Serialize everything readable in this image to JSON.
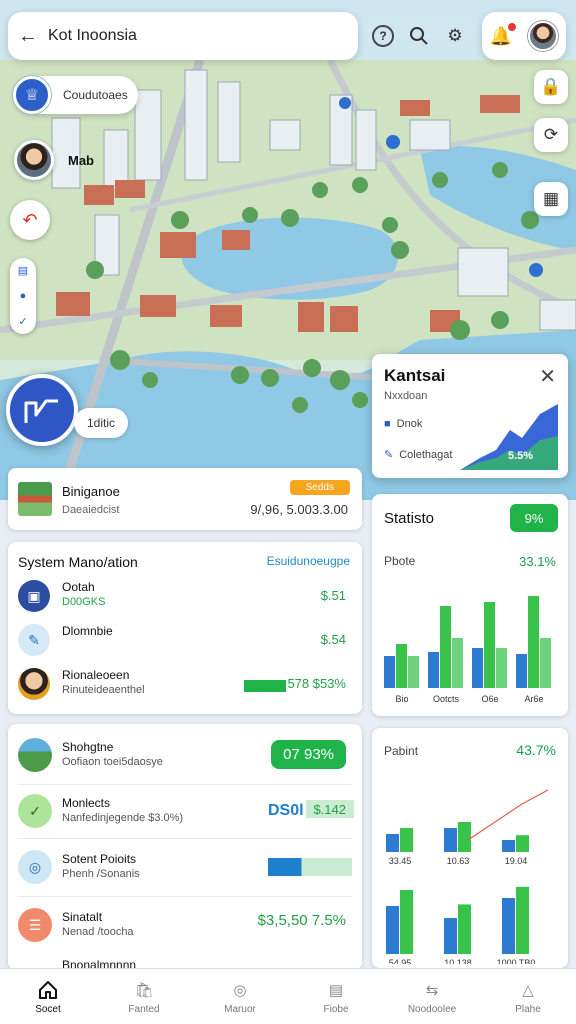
{
  "topbar": {
    "title": "Kot Inoonsia"
  },
  "map": {
    "pill_label": "Coudutoaes",
    "person_label": "Mab",
    "fab_label": "1ditic"
  },
  "popup": {
    "title": "Kantsai",
    "subtitle": "Nxxdoan",
    "item1": "Dnok",
    "item2": "Colethagat",
    "value": "5.5%"
  },
  "bin_card": {
    "title": "Biniganoe",
    "subtitle": "Daeaiedcist",
    "badge": "Sedds",
    "amount": "9/,96, 5.003.3.00"
  },
  "system_card": {
    "header": "System Mano/ation",
    "link": "Esuidunoeugpe",
    "rows": [
      {
        "title": "Ootah",
        "subtitle": "D00GKS",
        "value": "$.51"
      },
      {
        "title": "Dlomnbie",
        "subtitle": "",
        "value": "$.54"
      },
      {
        "title": "Rionaleoeen",
        "subtitle": "Rinuteideaenthel",
        "value": "578 $53%"
      }
    ]
  },
  "shops_card": {
    "rows": [
      {
        "title": "Shohgtne",
        "subtitle": "Oofiaon toei5daosye",
        "pill": "07 93%"
      },
      {
        "title": "Monlects",
        "subtitle": "Nanfedinjegende $3.0%)",
        "value": "DS0l",
        "value2": "$.142"
      },
      {
        "title": "Sotent Poioits",
        "subtitle": "Phenh /Sonanis",
        "value": ""
      },
      {
        "title": "Sinatalt",
        "subtitle": "Nenad /toocha",
        "value": "$3,5,50 7.5%"
      },
      {
        "title": "Bnonalmnnnn",
        "subtitle": "",
        "value": ""
      }
    ]
  },
  "stats_card": {
    "title": "Statisto",
    "badge": "9%",
    "label": "Pbote",
    "value": "33.1%"
  },
  "patients_card": {
    "label": "Pabint",
    "value": "43.7%"
  },
  "chart_data": [
    {
      "type": "bar",
      "categories": [
        "Bio",
        "Ootcts",
        "O6e",
        "Ar6e"
      ],
      "series": [
        {
          "values": [
            32,
            36,
            40,
            34
          ]
        },
        {
          "values": [
            44,
            82,
            86,
            92
          ]
        },
        {
          "values": [
            32,
            50,
            40,
            50
          ]
        }
      ],
      "colors": [
        "#2c7bd1",
        "#3ac34b",
        "#6cd37c"
      ]
    },
    {
      "type": "bar",
      "categories_top": [
        "33.45",
        "10.63",
        "19.04"
      ],
      "categories_bottom": [
        "54 95",
        "10 138",
        "1000 TB0"
      ],
      "series": [
        {
          "values": [
            30,
            40,
            20,
            60,
            45,
            70
          ]
        },
        {
          "values": [
            40,
            50,
            28,
            80,
            62,
            84
          ]
        }
      ],
      "colors": [
        "#2c7bd1",
        "#3ac34b"
      ]
    }
  ],
  "bottom_nav": [
    {
      "label": "Socet",
      "icon": "home-icon"
    },
    {
      "label": "Fanted",
      "icon": "bag-icon"
    },
    {
      "label": "Maruor",
      "icon": "compass-icon"
    },
    {
      "label": "Fiobe",
      "icon": "calendar-icon"
    },
    {
      "label": "Noodoolee",
      "icon": "swap-icon"
    },
    {
      "label": "Plahe",
      "icon": "warning-icon"
    }
  ]
}
